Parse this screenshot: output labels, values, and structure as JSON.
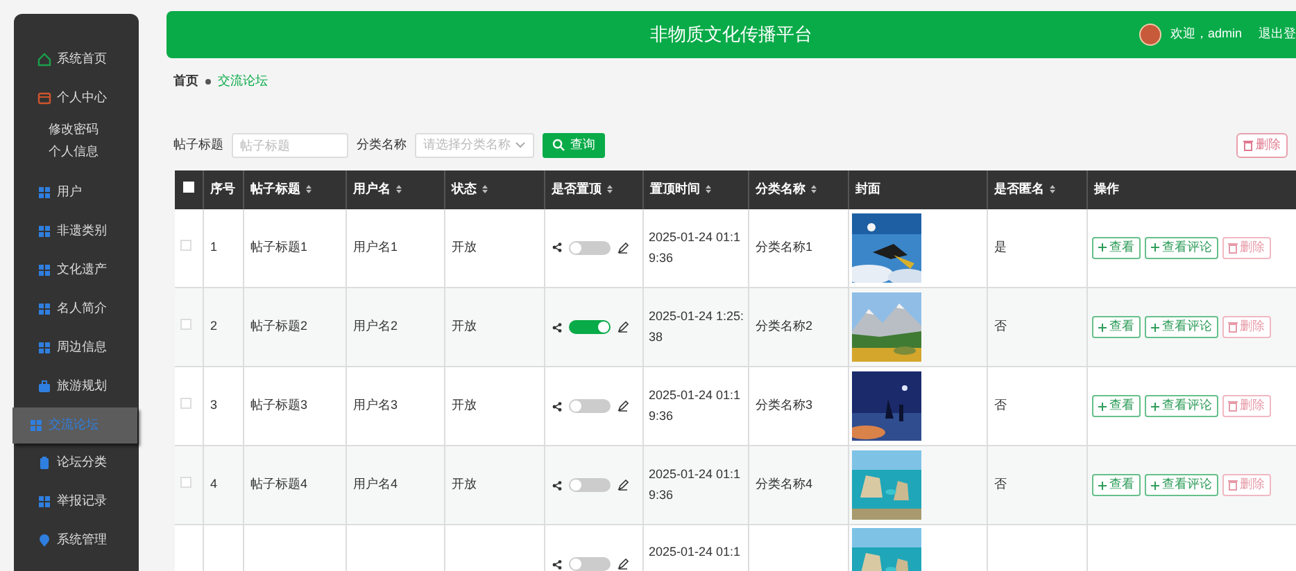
{
  "sidebar": {
    "items": [
      {
        "label": "系统首页",
        "kind": "home",
        "selected": false
      },
      {
        "label": "个人中心",
        "kind": "wallet",
        "selected": false,
        "children": [
          {
            "label": "修改密码"
          },
          {
            "label": "个人信息"
          }
        ]
      },
      {
        "label": "用户",
        "kind": "grid",
        "selected": false
      },
      {
        "label": "非遗类别",
        "kind": "grid",
        "selected": false
      },
      {
        "label": "文化遗产",
        "kind": "grid",
        "selected": false
      },
      {
        "label": "名人简介",
        "kind": "grid",
        "selected": false
      },
      {
        "label": "周边信息",
        "kind": "grid",
        "selected": false
      },
      {
        "label": "旅游规划",
        "kind": "briefcase",
        "selected": false
      },
      {
        "label": "交流论坛",
        "kind": "grid",
        "selected": true
      },
      {
        "label": "论坛分类",
        "kind": "clipboard",
        "selected": false
      },
      {
        "label": "举报记录",
        "kind": "grid",
        "selected": false
      },
      {
        "label": "系统管理",
        "kind": "pin",
        "selected": false
      }
    ]
  },
  "header": {
    "title": "非物质文化传播平台",
    "welcome": "欢迎，admin",
    "logout": "退出登"
  },
  "breadcrumb": [
    {
      "label": "首页"
    },
    {
      "label": "交流论坛"
    }
  ],
  "search": {
    "fields": [
      {
        "label": "帖子标题",
        "placeholder": "帖子标题",
        "kind": "text"
      },
      {
        "label": "分类名称",
        "placeholder": "请选择分类名称",
        "kind": "select"
      }
    ],
    "button": "查询",
    "delete_button": "删除"
  },
  "table": {
    "all_checked": false,
    "columns": [
      {
        "label": "序号",
        "sortable": false
      },
      {
        "label": "帖子标题",
        "sortable": true
      },
      {
        "label": "用户名",
        "sortable": true
      },
      {
        "label": "状态",
        "sortable": true
      },
      {
        "label": "是否置顶",
        "sortable": true
      },
      {
        "label": "置顶时间",
        "sortable": true
      },
      {
        "label": "分类名称",
        "sortable": true
      },
      {
        "label": "封面",
        "sortable": false
      },
      {
        "label": "是否匿名",
        "sortable": true
      },
      {
        "label": "操作",
        "sortable": false
      }
    ],
    "rows": [
      {
        "checked": false,
        "cells": [
          "1",
          "帖子标题1",
          "用户名1",
          "开放"
        ],
        "pinned": false,
        "time": "2025-01-24 01:19:36",
        "category": "分类名称1",
        "cover": {
          "kind": "picture"
        },
        "anonymous": "是",
        "actions": [
          {
            "label": "查看",
            "kind": "view"
          },
          {
            "label": "查看评论",
            "kind": "view"
          },
          {
            "label": "删除",
            "kind": "delete"
          }
        ]
      },
      {
        "checked": false,
        "cells": [
          "2",
          "帖子标题2",
          "用户名2",
          "开放"
        ],
        "pinned": true,
        "time": "2025-01-24 1:25:38",
        "category": "分类名称2",
        "cover": {
          "kind": "picture"
        },
        "anonymous": "否",
        "actions": [
          {
            "label": "查看",
            "kind": "view"
          },
          {
            "label": "查看评论",
            "kind": "view"
          },
          {
            "label": "删除",
            "kind": "delete"
          }
        ]
      },
      {
        "checked": false,
        "cells": [
          "3",
          "帖子标题3",
          "用户名3",
          "开放"
        ],
        "pinned": false,
        "time": "2025-01-24 01:19:36",
        "category": "分类名称3",
        "cover": {
          "kind": "picture"
        },
        "anonymous": "否",
        "actions": [
          {
            "label": "查看",
            "kind": "view"
          },
          {
            "label": "查看评论",
            "kind": "view"
          },
          {
            "label": "删除",
            "kind": "delete"
          }
        ]
      },
      {
        "checked": false,
        "cells": [
          "4",
          "帖子标题4",
          "用户名4",
          "开放"
        ],
        "pinned": false,
        "time": "2025-01-24 01:19:36",
        "category": "分类名称4",
        "cover": {
          "kind": "picture"
        },
        "anonymous": "否",
        "actions": [
          {
            "label": "查看",
            "kind": "view"
          },
          {
            "label": "查看评论",
            "kind": "view"
          },
          {
            "label": "删除",
            "kind": "delete"
          }
        ]
      },
      {
        "cells": [],
        "pinned": false,
        "time": "2025-01-24 01:1",
        "cover": {
          "kind": "picture"
        },
        "actions": []
      }
    ]
  }
}
